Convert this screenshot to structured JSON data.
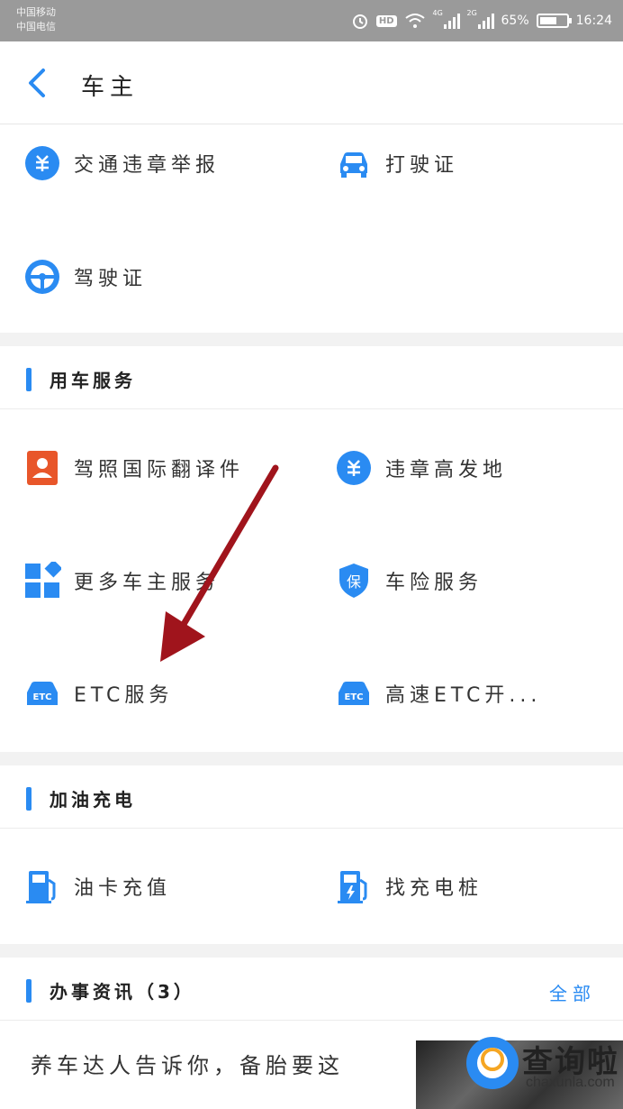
{
  "status_bar": {
    "carrier_1": "中国移动",
    "carrier_2": "中国电信",
    "hd": "HD",
    "net_1": "4G",
    "net_2": "2G",
    "battery": "65%",
    "battery_level": 0.65,
    "time": "16:24"
  },
  "header": {
    "title": "车主",
    "back_icon": "chevron-left-icon"
  },
  "top_services": [
    {
      "label": "交通违章举报",
      "icon": "violation-icon"
    },
    {
      "label": "打驶证",
      "icon": "car-icon"
    },
    {
      "label": "驾驶证",
      "icon": "steering-wheel-icon"
    }
  ],
  "vehicle_services": {
    "title": "用车服务",
    "items": [
      {
        "label": "驾照国际翻译件",
        "icon": "id-card-icon"
      },
      {
        "label": "违章高发地",
        "icon": "violation-icon"
      },
      {
        "label": "更多车主服务",
        "icon": "grid-icon"
      },
      {
        "label": "车险服务",
        "icon": "shield-icon"
      },
      {
        "label": "ETC服务",
        "icon": "etc-car-icon"
      },
      {
        "label": "高速ETC开...",
        "icon": "etc-car-icon"
      }
    ]
  },
  "fuel_charging": {
    "title": "加油充电",
    "items": [
      {
        "label": "油卡充值",
        "icon": "fuel-pump-icon"
      },
      {
        "label": "找充电桩",
        "icon": "charging-station-icon"
      }
    ]
  },
  "news": {
    "title": "办事资讯（3）",
    "more": "全部",
    "line_1": "养车达人告诉你，备胎要这"
  },
  "watermark": {
    "title": "查询啦",
    "domain": "chaxunla.com"
  },
  "colors": {
    "accent": "#2a8bf2",
    "annotation_arrow": "#a0141c",
    "status_bar": "#9a9a9a",
    "id_card": "#e8562a"
  }
}
